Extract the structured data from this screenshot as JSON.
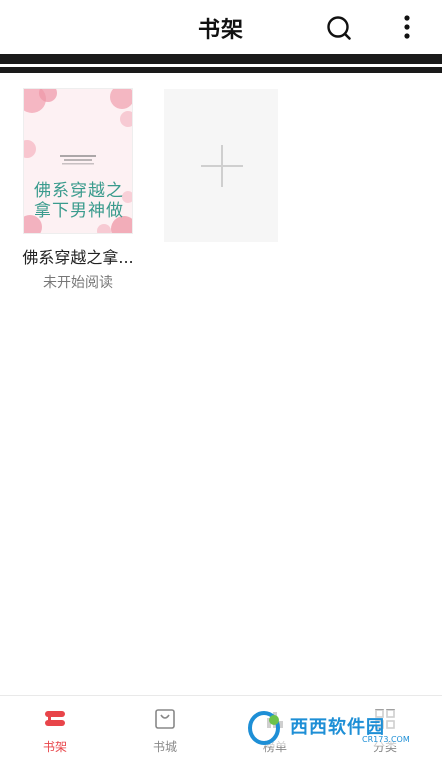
{
  "header": {
    "title": "书架",
    "search_icon": "search-icon",
    "more_icon": "more-vertical-icon"
  },
  "shelf": {
    "books": [
      {
        "title": "佛系穿越之拿...",
        "status": "未开始阅读",
        "cover_title": "佛系穿越之拿下男神做"
      }
    ],
    "add_tile_icon": "plus-icon"
  },
  "bottom_nav": {
    "active_color": "#e8454a",
    "items": [
      {
        "label": "书架",
        "icon": "bookshelf-icon",
        "active": true
      },
      {
        "label": "书城",
        "icon": "bag-icon",
        "active": false
      },
      {
        "label": "榜单",
        "icon": "ranking-icon",
        "active": false
      },
      {
        "label": "分类",
        "icon": "category-icon",
        "active": false
      }
    ]
  },
  "watermark": {
    "text": "西西软件园",
    "sub": "CR173.COM"
  }
}
